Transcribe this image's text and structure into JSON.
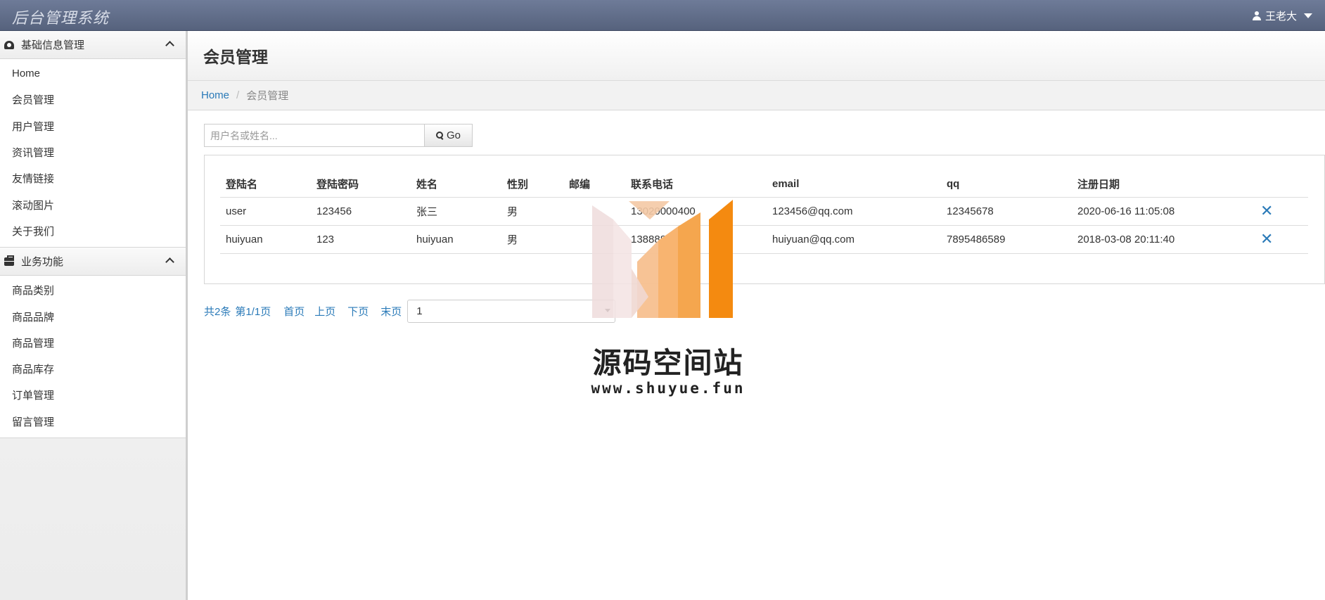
{
  "app": {
    "title": "后台管理系统",
    "user_name": "王老大"
  },
  "sidebar": {
    "groups": [
      {
        "title": "基础信息管理",
        "items": [
          "Home",
          "会员管理",
          "用户管理",
          "资讯管理",
          "友情链接",
          "滚动图片",
          "关于我们"
        ]
      },
      {
        "title": "业务功能",
        "items": [
          "商品类别",
          "商品品牌",
          "商品管理",
          "商品库存",
          "订单管理",
          "留言管理"
        ]
      }
    ]
  },
  "page": {
    "title": "会员管理"
  },
  "breadcrumb": {
    "home": "Home",
    "current": "会员管理"
  },
  "search": {
    "placeholder": "用户名或姓名...",
    "button_label": "Go"
  },
  "table": {
    "headers": [
      "登陆名",
      "登陆密码",
      "姓名",
      "性别",
      "邮编",
      "联系电话",
      "email",
      "qq",
      "注册日期"
    ],
    "rows": [
      {
        "login": "user",
        "password": "123456",
        "name": "张三",
        "gender": "男",
        "zip": "",
        "phone": "13020000400",
        "email": "123456@qq.com",
        "qq": "12345678",
        "date": "2020-06-16 11:05:08"
      },
      {
        "login": "huiyuan",
        "password": "123",
        "name": "huiyuan",
        "gender": "男",
        "zip": "",
        "phone": "13888888888",
        "email": "huiyuan@qq.com",
        "qq": "7895486589",
        "date": "2018-03-08 20:11:40"
      }
    ]
  },
  "pager": {
    "total": "共2条",
    "page_info": "第1/1页",
    "first": "首页",
    "prev": "上页",
    "next": "下页",
    "last": "末页",
    "selected_page": "1"
  },
  "watermark": {
    "title": "源码空间站",
    "url": "www.shuyue.fun"
  }
}
